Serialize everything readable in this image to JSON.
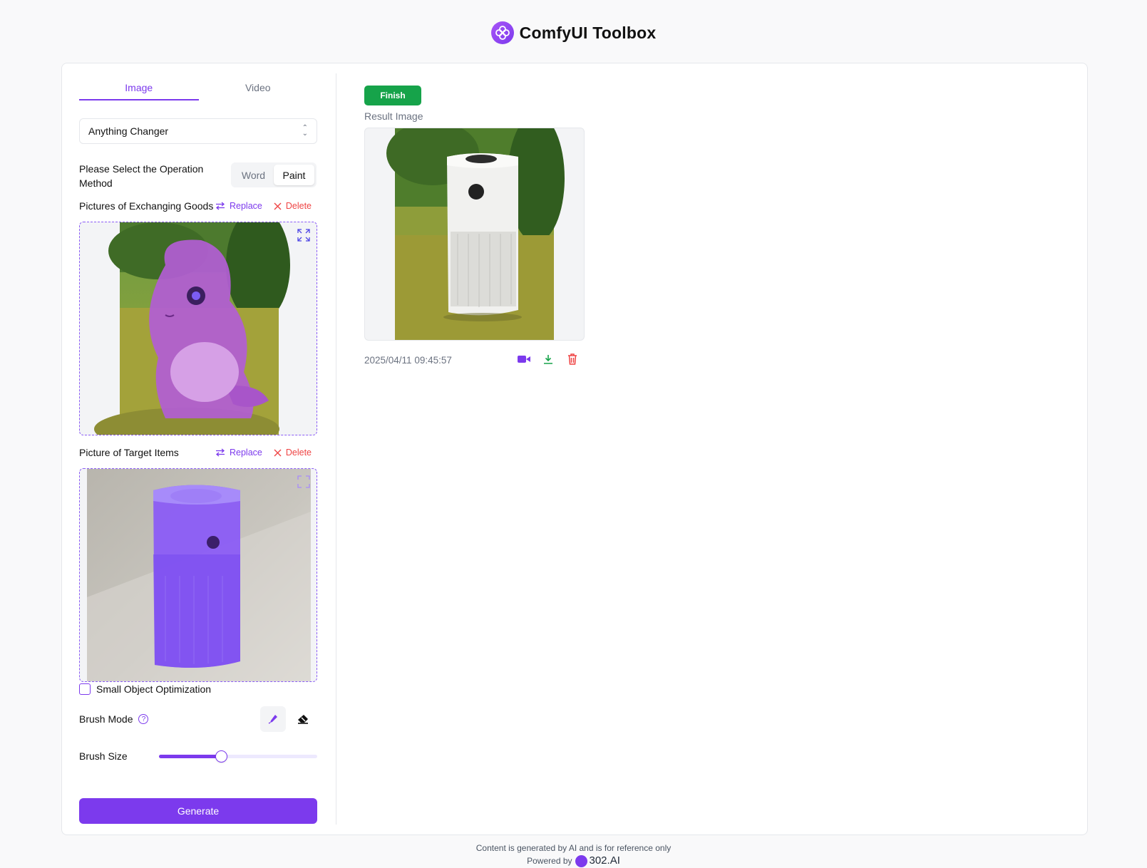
{
  "app": {
    "title": "ComfyUI Toolbox"
  },
  "tabs": {
    "image": "Image",
    "video": "Video"
  },
  "tool_select": {
    "value": "Anything Changer"
  },
  "operation": {
    "label": "Please Select the Operation Method",
    "options": [
      "Word",
      "Paint"
    ],
    "selected": "Paint"
  },
  "exchange_section": {
    "title": "Pictures of Exchanging Goods",
    "replace": "Replace",
    "delete": "Delete"
  },
  "target_section": {
    "title": "Picture of Target Items",
    "replace": "Replace",
    "delete": "Delete"
  },
  "small_object": {
    "label": "Small Object Optimization",
    "checked": false
  },
  "brush": {
    "mode_label": "Brush Mode",
    "size_label": "Brush Size",
    "size_fraction": 0.39
  },
  "generate": {
    "label": "Generate"
  },
  "result": {
    "status": "Finish",
    "label": "Result Image",
    "timestamp": "2025/04/11 09:45:57"
  },
  "footer": {
    "disclaimer": "Content is generated by AI and is for reference only",
    "powered_by": "Powered by",
    "brand": "302.AI"
  },
  "colors": {
    "accent": "#7c3aed",
    "success": "#16a34a",
    "danger": "#ef4444"
  }
}
